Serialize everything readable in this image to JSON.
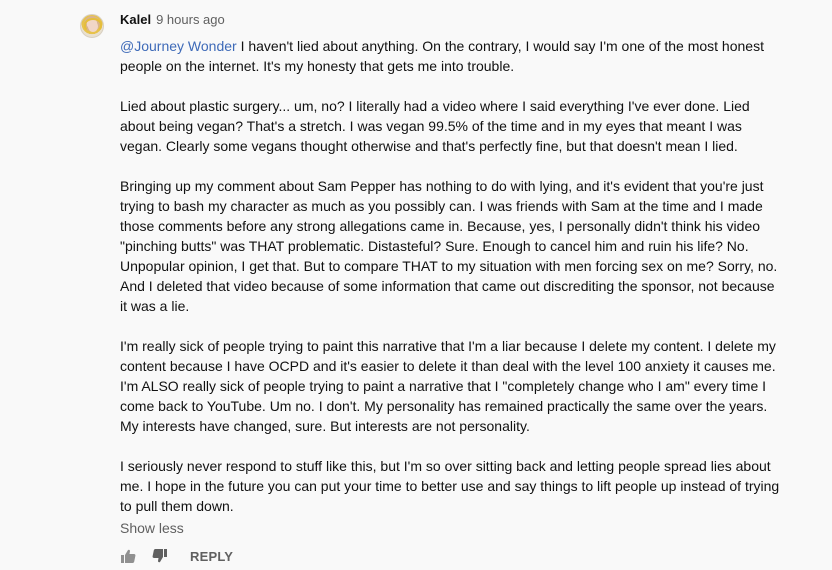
{
  "comment": {
    "author": "Kalel",
    "time": "9 hours ago",
    "mention": "@Journey Wonder",
    "first_text": " I haven't lied about anything. On the contrary, I would say I'm one of the most honest people on the internet. It's my honesty that gets me into trouble.",
    "paragraphs": [
      "Lied about plastic surgery... um, no? I literally had a video where I said everything I've ever done. Lied about being vegan? That's a stretch. I was vegan 99.5% of the time and in my eyes that meant I was vegan. Clearly some vegans thought otherwise and that's perfectly fine, but that doesn't mean I lied.",
      "Bringing up my comment about Sam Pepper has nothing to do with lying, and it's evident that you're just trying to bash my character as much as you possibly can. I was friends with Sam at the time and I made those comments before any strong allegations came in. Because, yes, I personally didn't think his video \"pinching butts\" was THAT problematic. Distasteful? Sure. Enough to cancel him and ruin his life? No. Unpopular opinion, I get that. But to compare THAT to my situation with men forcing sex on me? Sorry, no. And I deleted that video because of some information that came out discrediting the sponsor, not because it was a lie.",
      "I'm really sick of people trying to paint this narrative that I'm a liar because I delete my content. I delete my content because I have OCPD and it's easier to delete it than deal with the level 100 anxiety it causes me. I'm ALSO really sick of people trying to paint a narrative that I \"completely change who I am\" every time I come back to YouTube. Um no. I don't. My personality has remained practically the same over the years. My interests have changed, sure. But interests are not personality.",
      "I seriously never respond to stuff like this, but I'm so over sitting back and letting people spread lies about me. I hope in the future you can put your time to better use and say things to lift people up instead of trying to pull them down."
    ],
    "show_less_label": "Show less"
  },
  "actions": {
    "like_icon": "thumbs-up-icon",
    "dislike_icon": "thumbs-down-icon",
    "reply_label": "REPLY"
  },
  "colors": {
    "background": "#f9f9f9",
    "text": "#111111",
    "secondary": "#606060",
    "mention": "#3e6ab8"
  }
}
